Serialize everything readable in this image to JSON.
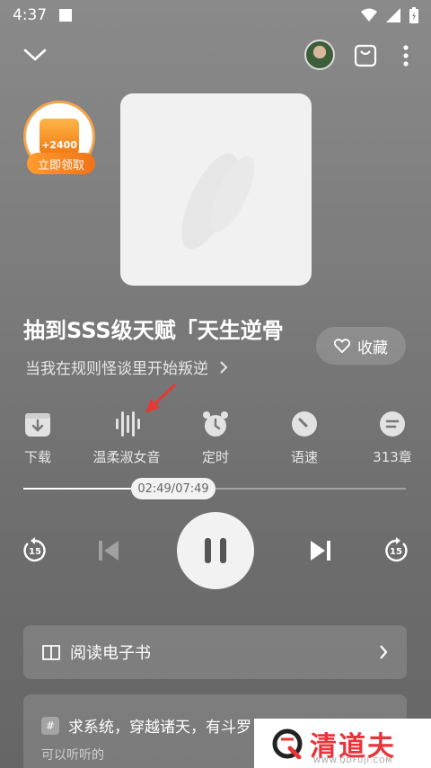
{
  "status_bar": {
    "time": "4:37"
  },
  "coin_reward": {
    "amount": "+2400",
    "claim_label": "立即领取"
  },
  "book": {
    "title": "抽到SSS级天赋「天生逆骨",
    "subtitle": "当我在规则怪谈里开始叛逆",
    "favorite_label": "收藏"
  },
  "functions": [
    {
      "label": "下载",
      "icon": "download-icon"
    },
    {
      "label": "温柔淑女音",
      "icon": "voice-wave-icon"
    },
    {
      "label": "定时",
      "icon": "alarm-clock-icon"
    },
    {
      "label": "语速",
      "icon": "speed-gauge-icon"
    },
    {
      "label": "313章",
      "icon": "chapter-list-icon"
    }
  ],
  "player": {
    "time_display": "02:49/07:49",
    "progress_fraction": 0.3617,
    "rewind_seconds": "15",
    "forward_seconds": "15"
  },
  "ebook": {
    "label": "阅读电子书"
  },
  "recommendation": {
    "title": "求系统，穿越诸天，有斗罗",
    "subtitle": "可以听听的",
    "tag_icon": "#"
  },
  "watermark": {
    "brand": "清道夫",
    "url": "WWW.QDFUJI.COM"
  },
  "colors": {
    "accent_orange": "#f07318",
    "watermark_red": "#e8343b",
    "arrow_red": "#e53935"
  }
}
